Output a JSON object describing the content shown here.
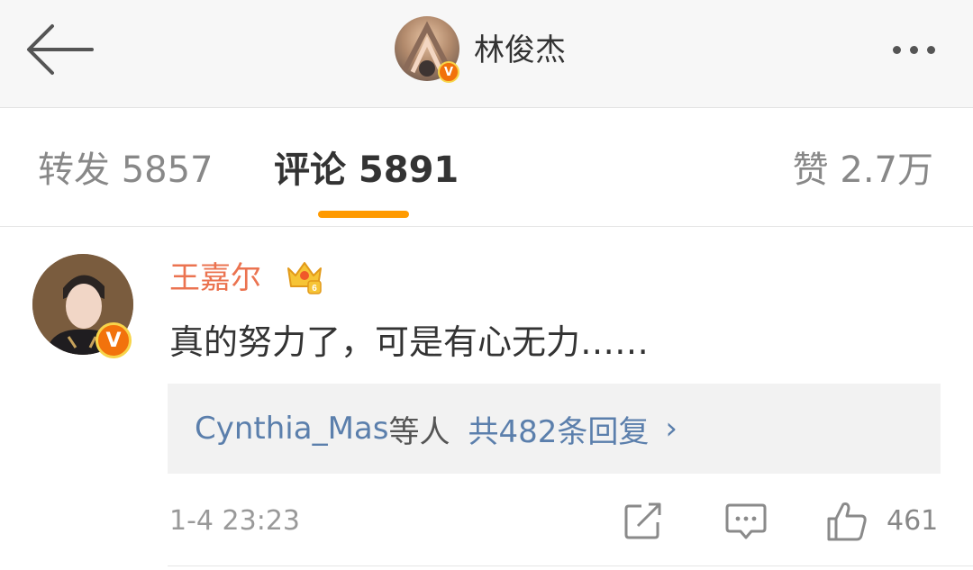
{
  "header": {
    "title": "林俊杰",
    "verified_badge": "V",
    "back_icon": "back-arrow-icon",
    "more_icon": "more-icon"
  },
  "tabs": {
    "forward_label": "转发 5857",
    "comment_label": "评论 5891",
    "like_label": "赞 2.7万",
    "active": "comment",
    "accent_color": "#ff9a00"
  },
  "comment": {
    "user_name": "王嘉尔",
    "verified_badge": "V",
    "text": "真的努力了，可是有心无力……",
    "replies": {
      "who": "Cynthia_Mas",
      "mid": "等人",
      "count": "共482条回复",
      "chevron": "›"
    },
    "time": "1-4 23:23",
    "like_count": "461",
    "user_color": "#eb7350",
    "link_color": "#5b7fac"
  }
}
